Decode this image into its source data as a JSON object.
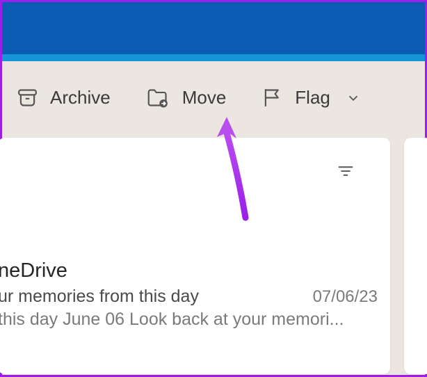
{
  "toolbar": {
    "archive_label": "Archive",
    "move_label": "Move",
    "flag_label": "Flag"
  },
  "email": {
    "from": "neDrive",
    "subject": "ur memories from this day",
    "date": "07/06/23",
    "preview": " this day June 06 Look back at your memori..."
  },
  "colors": {
    "header": "#0a5cb3",
    "accent": "#1496d6",
    "toolbar_bg": "#ece6e0",
    "annotation": "#9b1fe8"
  }
}
